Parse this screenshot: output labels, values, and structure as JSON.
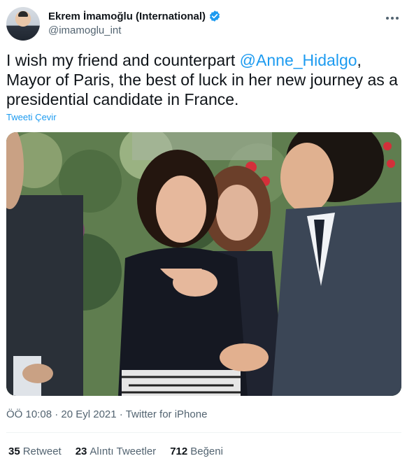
{
  "author": {
    "display_name": "Ekrem İmamoğlu (International)",
    "handle": "@imamoglu_int"
  },
  "tweet": {
    "text_before": "I wish my friend and counterpart ",
    "mention": "@Anne_Hidalgo",
    "text_after": ", Mayor of Paris, the best of luck in her new journey as a presidential candidate in France.",
    "translate_label": "Tweeti Çevir"
  },
  "meta": {
    "time": "ÖÖ 10:08",
    "separator": " · ",
    "date": "20 Eyl 2021",
    "source": "Twitter for iPhone"
  },
  "stats": {
    "retweets": {
      "count": "35",
      "label": "Retweet"
    },
    "quotes": {
      "count": "23",
      "label": "Alıntı Tweetler"
    },
    "likes": {
      "count": "712",
      "label": "Beğeni"
    }
  },
  "colors": {
    "accent": "#1d9bf0",
    "text": "#0f1419",
    "muted": "#536471"
  },
  "icons": {
    "verified": "verified-badge-icon",
    "more": "more-horizontal-icon"
  }
}
